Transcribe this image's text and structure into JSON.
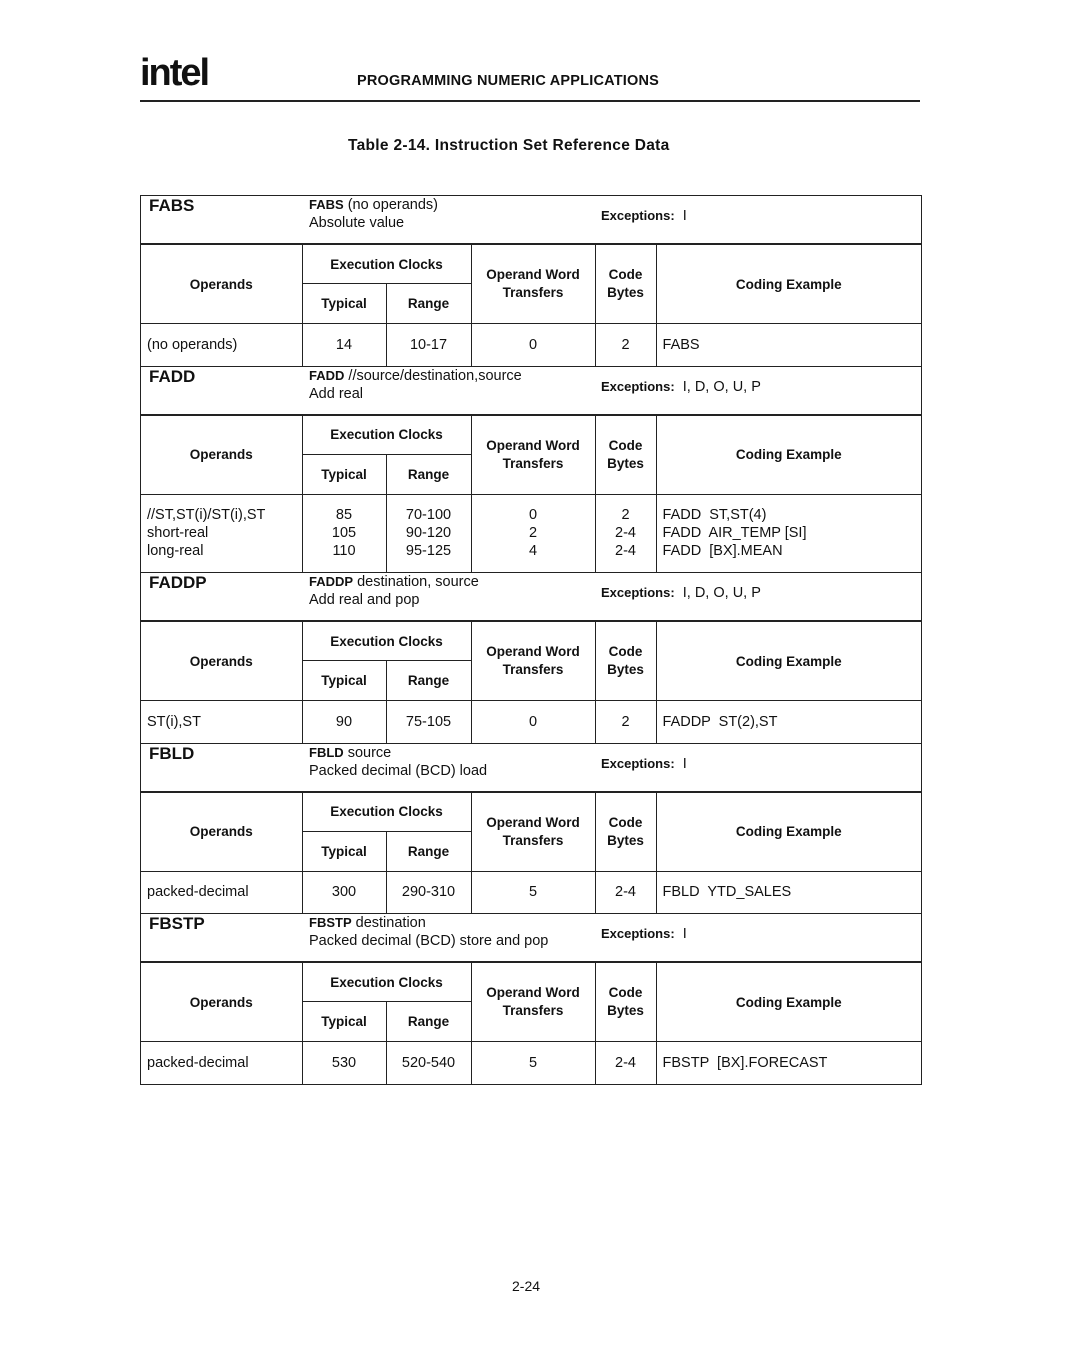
{
  "header": {
    "logo_text": "intel",
    "running_head": "PROGRAMMING NUMERIC APPLICATIONS",
    "table_title": "Table 2-14.  Instruction Set Reference Data"
  },
  "column_headers": {
    "operands": "Operands",
    "execution_clocks": "Execution Clocks",
    "typical": "Typical",
    "range": "Range",
    "operand_word_transfers": "Operand Word Transfers",
    "code_bytes": "Code Bytes",
    "coding_example": "Coding Example",
    "exceptions_label": "Exceptions:"
  },
  "instructions": [
    {
      "name": "FABS",
      "syntax_mnemonic": "FABS",
      "syntax_args": " (no operands)",
      "description": "Absolute value",
      "exceptions": "I",
      "rows": [
        {
          "operands": "(no operands)",
          "typical": "14",
          "range": "10-17",
          "transfers": "0",
          "bytes": "2",
          "example": "FABS"
        }
      ]
    },
    {
      "name": "FADD",
      "syntax_mnemonic": "FADD",
      "syntax_args": " //source/destination,source",
      "description": "Add real",
      "exceptions": "I, D, O, U, P",
      "rows": [
        {
          "operands": "//ST,ST(i)/ST(i),ST",
          "typical": "85",
          "range": "70-100",
          "transfers": "0",
          "bytes": "2",
          "example": "FADD  ST,ST(4)"
        },
        {
          "operands": "short-real",
          "typical": "105",
          "range": "90-120",
          "transfers": "2",
          "bytes": "2-4",
          "example": "FADD  AIR_TEMP [SI]"
        },
        {
          "operands": "long-real",
          "typical": "110",
          "range": "95-125",
          "transfers": "4",
          "bytes": "2-4",
          "example": "FADD  [BX].MEAN"
        }
      ]
    },
    {
      "name": "FADDP",
      "syntax_mnemonic": "FADDP",
      "syntax_args": " destination, source",
      "description": "Add real and pop",
      "exceptions": "I, D, O, U, P",
      "rows": [
        {
          "operands": "ST(i),ST",
          "typical": "90",
          "range": "75-105",
          "transfers": "0",
          "bytes": "2",
          "example": "FADDP  ST(2),ST"
        }
      ]
    },
    {
      "name": "FBLD",
      "syntax_mnemonic": "FBLD",
      "syntax_args": " source",
      "description": "Packed decimal (BCD) load",
      "exceptions": "I",
      "rows": [
        {
          "operands": "packed-decimal",
          "typical": "300",
          "range": "290-310",
          "transfers": "5",
          "bytes": "2-4",
          "example": "FBLD  YTD_SALES"
        }
      ]
    },
    {
      "name": "FBSTP",
      "syntax_mnemonic": "FBSTP",
      "syntax_args": " destination",
      "description": "Packed decimal (BCD) store and pop",
      "exceptions": "I",
      "rows": [
        {
          "operands": "packed-decimal",
          "typical": "530",
          "range": "520-540",
          "transfers": "5",
          "bytes": "2-4",
          "example": "FBSTP  [BX].FORECAST"
        }
      ]
    }
  ],
  "footer": {
    "page_number": "2-24"
  }
}
